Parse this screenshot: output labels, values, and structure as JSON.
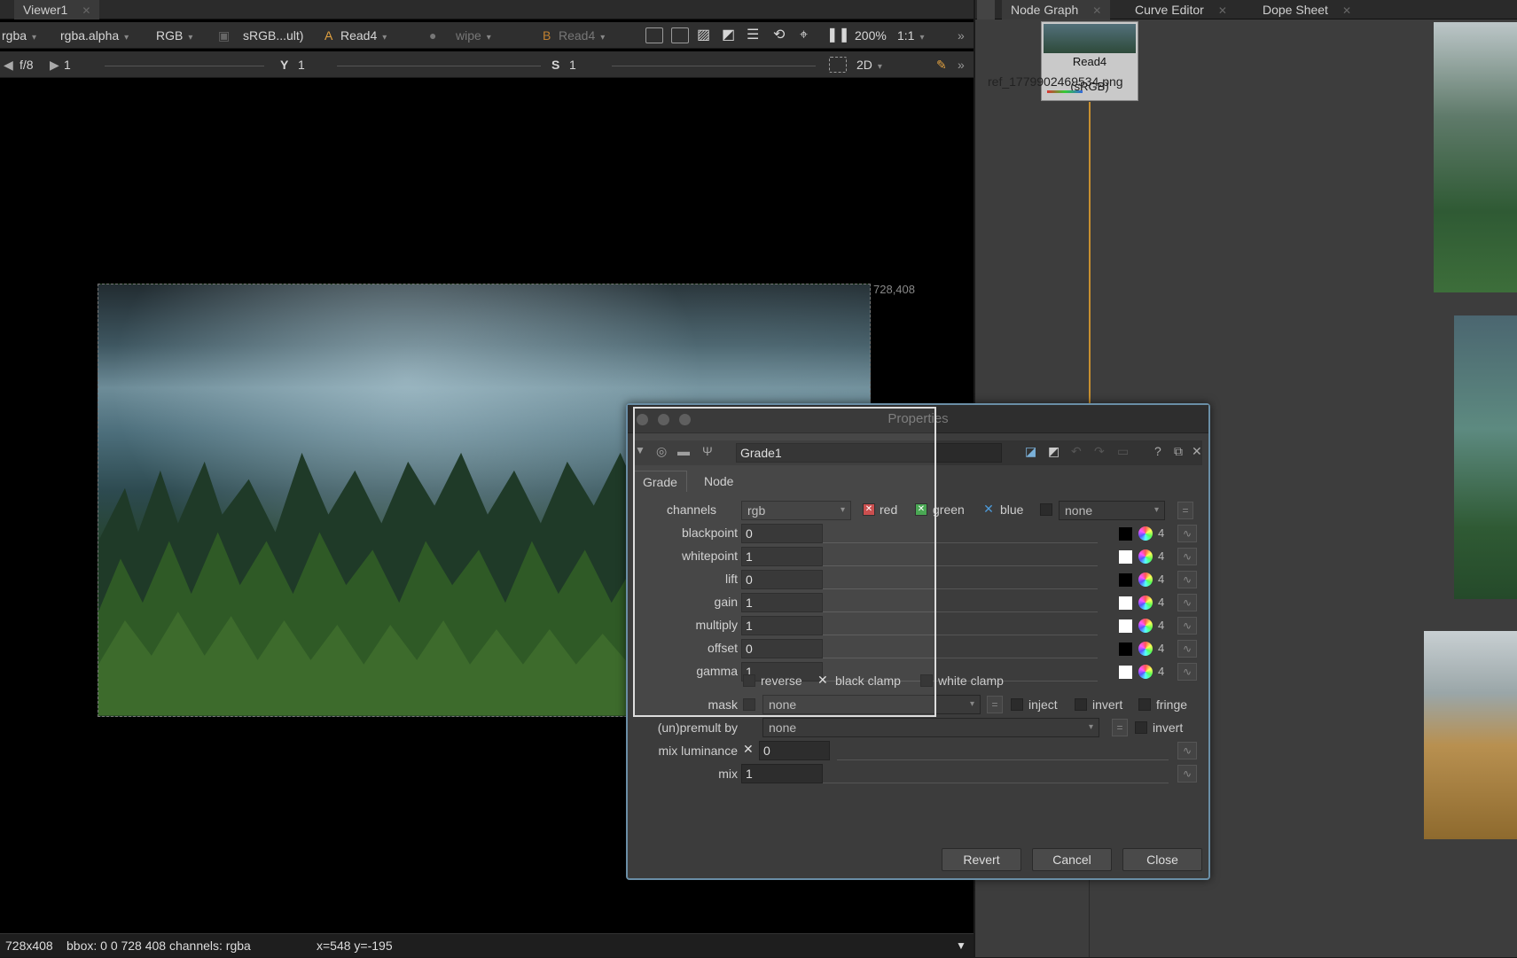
{
  "viewer": {
    "tab_label": "Viewer1",
    "toolbar1": {
      "channels": "rgba",
      "alpha": "rgba.alpha",
      "display": "RGB",
      "lut": "sRGB...ult)",
      "a_label": "A",
      "a_input": "Read4",
      "wipe": "wipe",
      "b_label": "B",
      "b_input": "Read4",
      "zoom": "200%",
      "ratio": "1:1"
    },
    "toolbar2": {
      "fstop": "f/8",
      "gain_value": "1",
      "y_label": "Y",
      "y_value": "1",
      "s_label": "S",
      "s_value": "1",
      "mode": "2D"
    },
    "image_coord": "728,408",
    "status_format": "728x408",
    "status_bbox": "bbox: 0 0 728 408 channels: rgba",
    "status_pos": "x=548 y=-195"
  },
  "right_tabs": [
    {
      "label": "Node Graph"
    },
    {
      "label": "Curve Editor"
    },
    {
      "label": "Dope Sheet"
    }
  ],
  "node": {
    "name": "Read4",
    "file": "ref_1779902469534.png",
    "colorspace": "(sRGB)"
  },
  "properties": {
    "title": "Properties",
    "node_name": "Grade1",
    "tabs": [
      "Grade",
      "Node"
    ],
    "channels_label": "channels",
    "channels_value": "rgb",
    "ch_red": "red",
    "ch_green": "green",
    "ch_blue": "blue",
    "ch_extra": "none",
    "rows": [
      {
        "label": "blackpoint",
        "value": "0",
        "swatch": "#000000"
      },
      {
        "label": "whitepoint",
        "value": "1",
        "swatch": "#ffffff"
      },
      {
        "label": "lift",
        "value": "0",
        "swatch": "#000000"
      },
      {
        "label": "gain",
        "value": "1",
        "swatch": "#ffffff"
      },
      {
        "label": "multiply",
        "value": "1",
        "swatch": "#ffffff"
      },
      {
        "label": "offset",
        "value": "0",
        "swatch": "#000000"
      },
      {
        "label": "gamma",
        "value": "1",
        "swatch": "#ffffff"
      }
    ],
    "four": "4",
    "reverse": "reverse",
    "black_clamp": "black clamp",
    "white_clamp": "white clamp",
    "mask_label": "mask",
    "mask_value": "none",
    "inject": "inject",
    "invert": "invert",
    "fringe": "fringe",
    "premult_label": "(un)premult by",
    "premult_value": "none",
    "invert2": "invert",
    "mixlum_label": "mix luminance",
    "mixlum_value": "0",
    "mix_label": "mix",
    "mix_value": "1",
    "buttons": {
      "revert": "Revert",
      "cancel": "Cancel",
      "close": "Close"
    }
  },
  "colors": {
    "accent": "#6a8ea6",
    "pipe": "#c89030"
  }
}
